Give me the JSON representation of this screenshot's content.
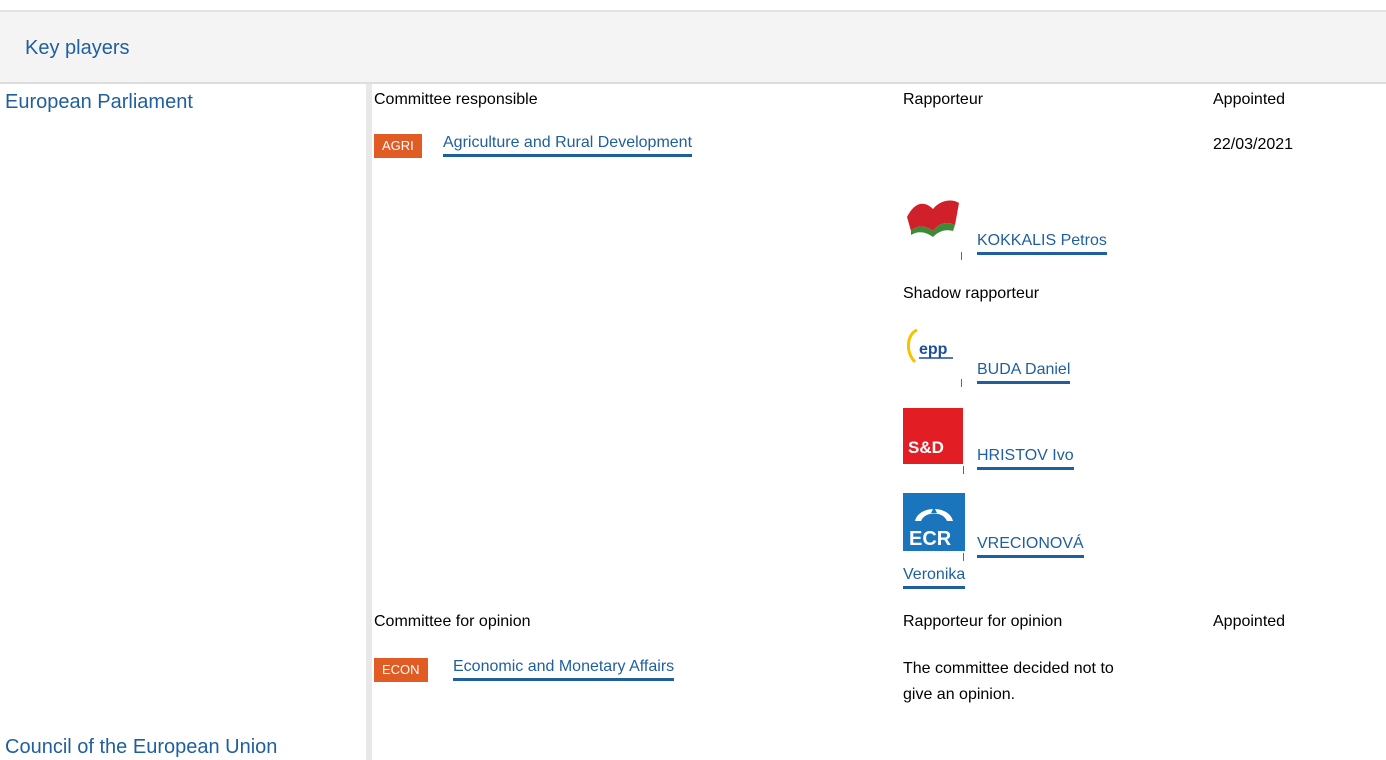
{
  "header": {
    "title": "Key players"
  },
  "sections": {
    "ep": {
      "title": "European Parliament"
    },
    "council": {
      "title": "Council of the European Union"
    }
  },
  "responsible": {
    "col_committee": "Committee responsible",
    "col_rapporteur": "Rapporteur",
    "col_appointed": "Appointed",
    "committee_code": "AGRI",
    "committee_name": "Agriculture and Rural Development",
    "appointed_date": "22/03/2021",
    "rapporteur": {
      "name": "KOKKALIS Petros",
      "group_icon": "gue-ngl-flag-logo"
    },
    "shadow_label": "Shadow rapporteur",
    "shadows": [
      {
        "name": "BUDA Daniel",
        "group_icon": "epp-logo",
        "group_text": "epp"
      },
      {
        "name": "HRISTOV Ivo",
        "group_icon": "sd-logo",
        "group_text": "S&D"
      },
      {
        "name_line1": "VRECIONOVÁ",
        "name_line2": "Veronika",
        "group_icon": "ecr-logo",
        "group_text": "ECR"
      }
    ]
  },
  "opinion": {
    "col_committee": "Committee for opinion",
    "col_rapporteur": "Rapporteur for opinion",
    "col_appointed": "Appointed",
    "committee_code": "ECON",
    "committee_name": "Economic and Monetary Affairs",
    "note_line1": "The committee decided not to",
    "note_line2": "give an opinion."
  },
  "colors": {
    "link": "#1f5f9e",
    "badge": "#e05c24",
    "header_bg": "#f4f4f4"
  }
}
